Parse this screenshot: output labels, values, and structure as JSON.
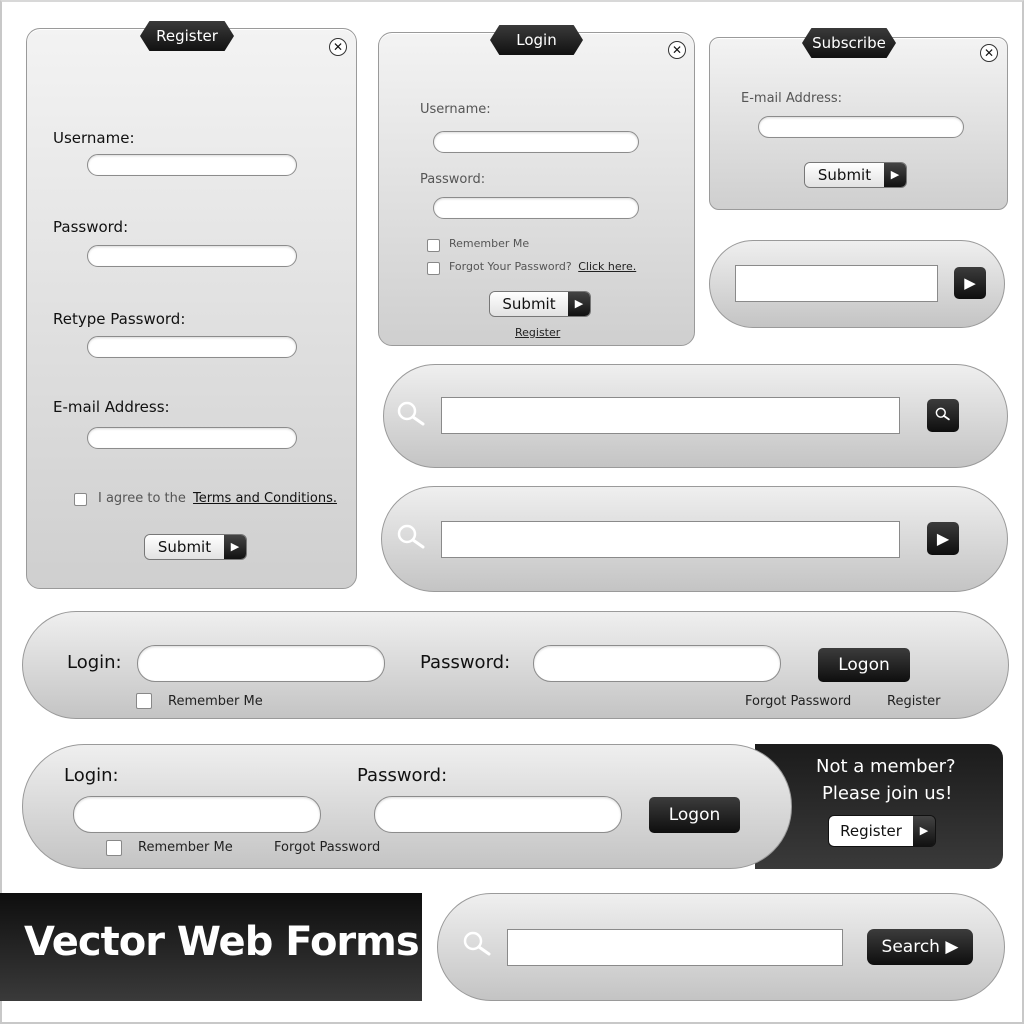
{
  "register_form": {
    "tab": "Register",
    "close_icon": "close-icon",
    "fields": [
      {
        "label": "Username:",
        "value": ""
      },
      {
        "label": "Password:",
        "value": ""
      },
      {
        "label": "Retype Password:",
        "value": ""
      },
      {
        "label": "E-mail Address:",
        "value": ""
      }
    ],
    "agree_text": "I agree to the",
    "terms_link": "Terms and Conditions.",
    "submit_label": "Submit",
    "submit_arrow": "▶"
  },
  "login_form": {
    "tab": "Login",
    "username_label": "Username:",
    "password_label": "Password:",
    "remember_label": "Remember Me",
    "forgot_label": "Forgot Your Password?",
    "click_here": "Click here.",
    "submit_label": "Submit",
    "submit_arrow": "▶",
    "register_link": "Register"
  },
  "subscribe_form": {
    "tab": "Subscribe",
    "email_label": "E-mail Address:",
    "submit_label": "Submit",
    "submit_arrow": "▶"
  },
  "mini_input": {
    "go_icon": "▶"
  },
  "search_bar_1": {
    "icon": "search-icon",
    "button_icon": "search-icon"
  },
  "search_bar_2": {
    "icon": "search-icon",
    "button_icon": "▶"
  },
  "login_bar_1": {
    "login_label": "Login:",
    "password_label": "Password:",
    "logon_label": "Logon",
    "remember_label": "Remember Me",
    "forgot_label": "Forgot Password",
    "register_label": "Register"
  },
  "login_bar_2": {
    "login_label": "Login:",
    "password_label": "Password:",
    "logon_label": "Logon",
    "remember_label": "Remember Me",
    "forgot_label": "Forgot Password",
    "join_line1": "Not a member?",
    "join_line2": "Please join us!",
    "register_label": "Register",
    "register_arrow": "▶"
  },
  "title": "Vector Web Forms",
  "search_bar_3": {
    "button_label": "Search ▶"
  }
}
